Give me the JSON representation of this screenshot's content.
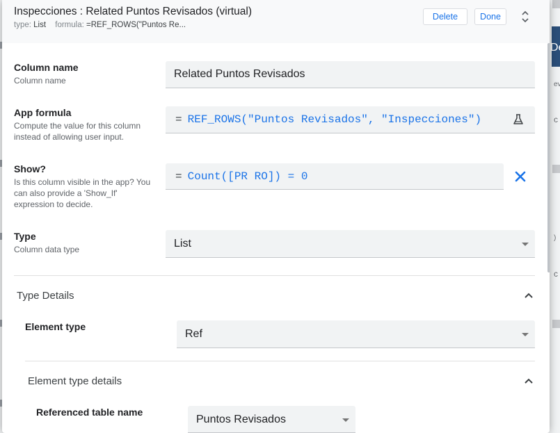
{
  "background": {
    "letter": "De",
    "snippets": [
      "ev",
      "c",
      ")",
      "c"
    ]
  },
  "header": {
    "title": "Inspecciones : Related Puntos Revisados (virtual)",
    "type_key": "type:",
    "type_value": "List",
    "formula_key": "formula:",
    "formula_value": "=REF_ROWS(\"Puntos Re...",
    "delete_label": "Delete",
    "done_label": "Done"
  },
  "fields": {
    "column_name": {
      "label": "Column name",
      "description": "Column name",
      "value": "Related Puntos Revisados"
    },
    "app_formula": {
      "label": "App formula",
      "description": "Compute the value for this column instead of allowing user input.",
      "eq": "=",
      "value": "REF_ROWS(\"Puntos Revisados\", \"Inspecciones\")"
    },
    "show": {
      "label": "Show?",
      "description": "Is this column visible in the app? You can also provide a 'Show_If' expression to decide.",
      "eq": "=",
      "value": "Count([PR RO]) = 0"
    },
    "type": {
      "label": "Type",
      "description": "Column data type",
      "value": "List"
    }
  },
  "type_details": {
    "title": "Type Details",
    "element_type": {
      "label": "Element type",
      "value": "Ref"
    },
    "element_type_details": {
      "title": "Element type details",
      "referenced_table": {
        "label": "Referenced table name",
        "value": "Puntos Revisados"
      }
    }
  },
  "colors": {
    "accent": "#1a73e8",
    "field_bg": "#f1f3f4",
    "header_bg": "#f8f9fa"
  }
}
